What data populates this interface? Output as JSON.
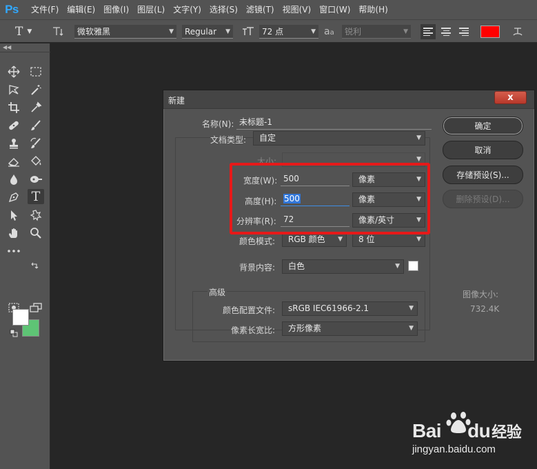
{
  "app": {
    "logo": "Ps"
  },
  "menu": [
    "文件(F)",
    "编辑(E)",
    "图像(I)",
    "图层(L)",
    "文字(Y)",
    "选择(S)",
    "滤镜(T)",
    "视图(V)",
    "窗口(W)",
    "帮助(H)"
  ],
  "options_bar": {
    "tool_glyph": "T",
    "font_family": "微软雅黑",
    "font_style": "Regular",
    "font_size": "72 点",
    "aa_glyph": "a",
    "antialias": "锐利",
    "text_color": "#ff0000"
  },
  "toolbox": {
    "foreground_color": "#ffffff",
    "background_color": "#5ec475"
  },
  "dialog": {
    "title": "新建",
    "close_glyph": "x",
    "name_label": "名称(N):",
    "name_value": "未标题-1",
    "doc_type_label": "文档类型:",
    "doc_type_value": "自定",
    "size_label": "大小:",
    "width_label": "宽度(W):",
    "width_value": "500",
    "width_unit": "像素",
    "height_label": "高度(H):",
    "height_value": "500",
    "height_unit": "像素",
    "resolution_label": "分辨率(R):",
    "resolution_value": "72",
    "resolution_unit": "像素/英寸",
    "color_mode_label": "颜色模式:",
    "color_mode_value": "RGB 颜色",
    "bit_depth_value": "8 位",
    "background_label": "背景内容:",
    "background_value": "白色",
    "background_swatch": "#ffffff",
    "advanced_label": "高级",
    "color_profile_label": "颜色配置文件:",
    "color_profile_value": "sRGB IEC61966-2.1",
    "pixel_aspect_label": "像素长宽比:",
    "pixel_aspect_value": "方形像素",
    "ok_button": "确定",
    "cancel_button": "取消",
    "save_preset_button": "存储预设(S)...",
    "delete_preset_button": "删除预设(D)...",
    "image_size_label": "图像大小:",
    "image_size_value": "732.4K"
  },
  "watermark": {
    "brand_latin_1": "Bai",
    "brand_latin_2": "du",
    "brand_cn": "经验",
    "url": "jingyan.baidu.com"
  }
}
